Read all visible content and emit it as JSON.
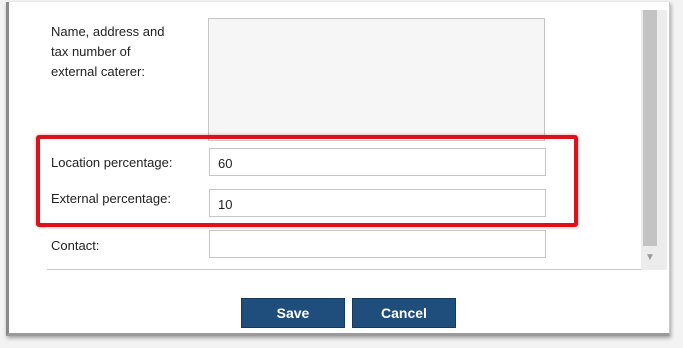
{
  "form": {
    "caterer_label_lines": [
      "Name, address and",
      "tax number of",
      "external caterer:"
    ],
    "caterer_value": "",
    "location_label": "Location percentage:",
    "location_value": "60",
    "external_label": "External percentage:",
    "external_value": "10",
    "contact_label": "Contact:",
    "contact_value": ""
  },
  "buttons": {
    "save": "Save",
    "cancel": "Cancel"
  },
  "colors": {
    "button_bg": "#1f4e7c",
    "highlight": "#e0101a"
  }
}
